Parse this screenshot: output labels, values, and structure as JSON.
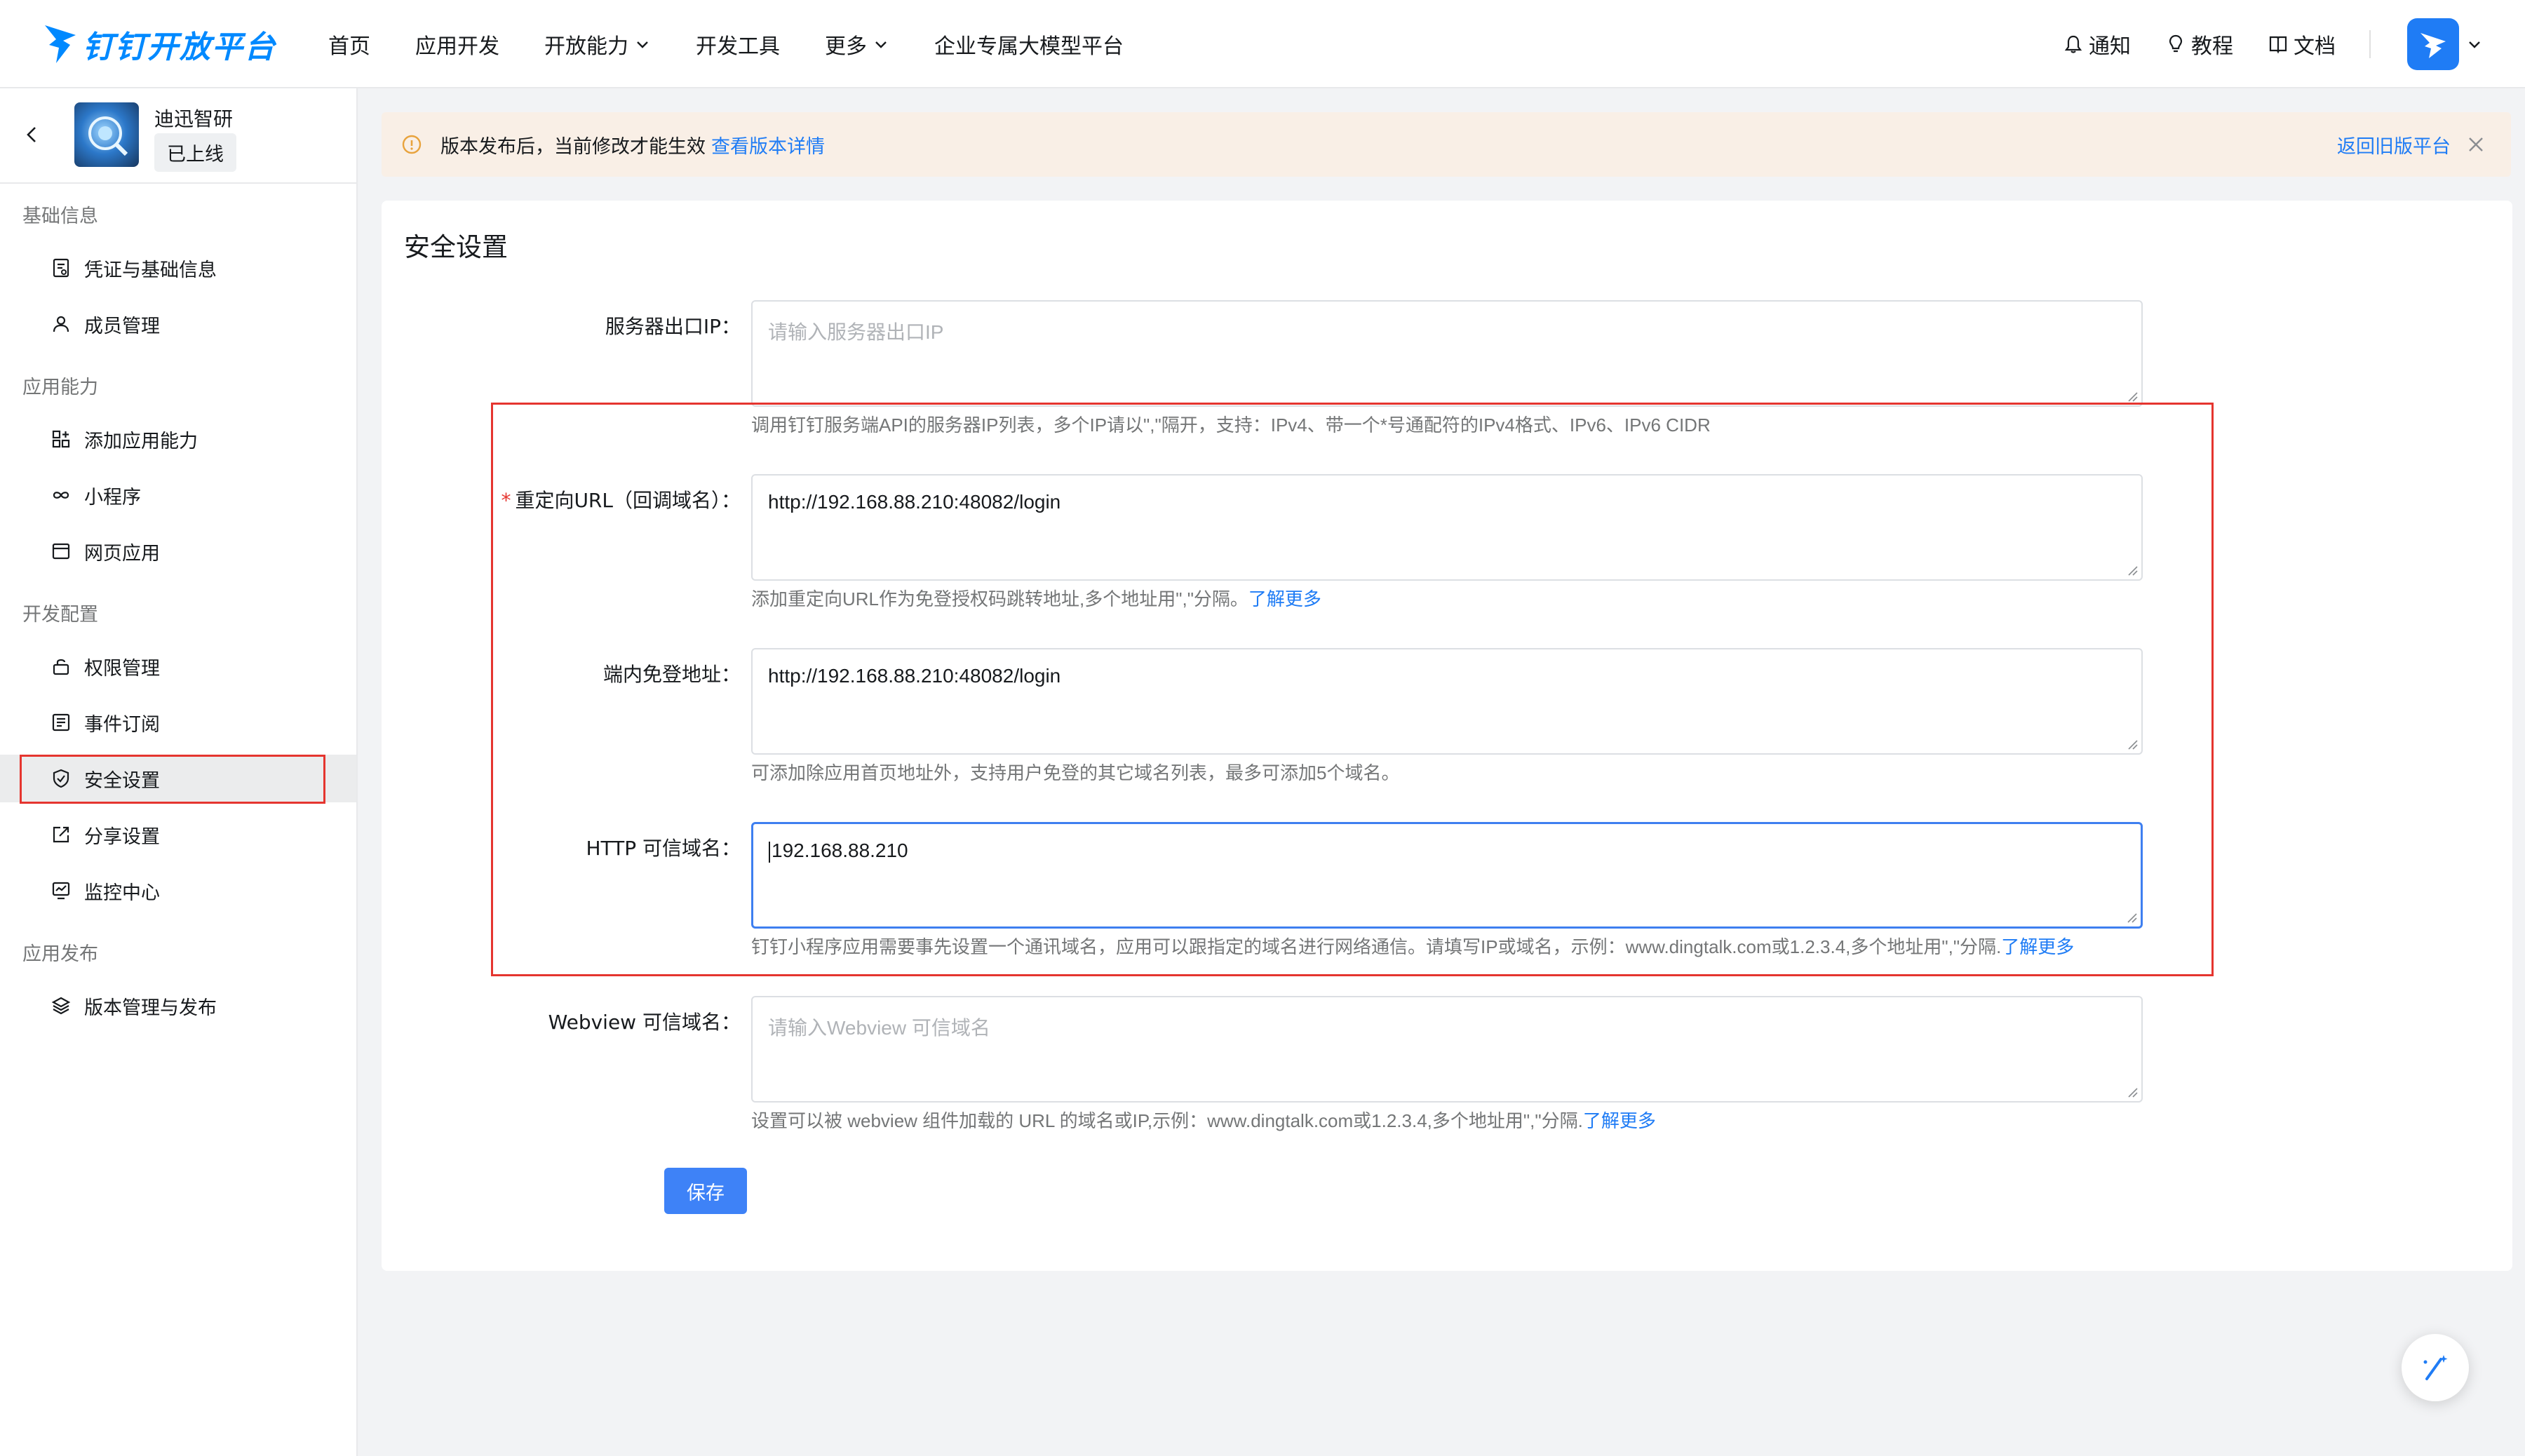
{
  "header": {
    "logo_text": "钉钉开放平台",
    "nav": [
      "首页",
      "应用开发",
      "开放能力",
      "开发工具",
      "更多",
      "企业专属大模型平台"
    ],
    "notify_label": "通知",
    "tutorial_label": "教程",
    "docs_label": "文档"
  },
  "sidebar": {
    "app_name": "迪迅智研",
    "app_status": "已上线",
    "sections": {
      "basic": "基础信息",
      "capability": "应用能力",
      "dev_config": "开发配置",
      "publish": "应用发布"
    },
    "items": {
      "credentials": "凭证与基础信息",
      "members": "成员管理",
      "add_capability": "添加应用能力",
      "mini_program": "小程序",
      "web_app": "网页应用",
      "permissions": "权限管理",
      "events": "事件订阅",
      "security": "安全设置",
      "share": "分享设置",
      "monitor": "监控中心",
      "versions": "版本管理与发布"
    },
    "active_item": "安全设置"
  },
  "notice": {
    "text": "版本发布后，当前修改才能生效",
    "link": "查看版本详情",
    "back": "返回旧版平台",
    "color": "#f9efe6"
  },
  "main": {
    "title": "安全设置",
    "fields": {
      "server_ip": {
        "label": "服务器出口IP：",
        "placeholder": "请输入服务器出口IP",
        "value": "",
        "hint": "调用钉钉服务端API的服务器IP列表，多个IP请以\",\"隔开，支持：IPv4、带一个*号通配符的IPv4格式、IPv6、IPv6 CIDR"
      },
      "redirect_url": {
        "label": "重定向URL（回调域名）：",
        "required": "*",
        "value": "http://192.168.88.210:48082/login",
        "hint": "添加重定向URL作为免登授权码跳转地址,多个地址用\",\"分隔。",
        "hint_link": "了解更多"
      },
      "inapp_login": {
        "label": "端内免登地址：",
        "value": "http://192.168.88.210:48082/login",
        "hint": "可添加除应用首页地址外，支持用户免登的其它域名列表，最多可添加5个域名。"
      },
      "http_domain": {
        "label": "HTTP 可信域名：",
        "value": "192.168.88.210",
        "hint": "钉钉小程序应用需要事先设置一个通讯域名，应用可以跟指定的域名进行网络通信。请填写IP或域名，示例：www.dingtalk.com或1.2.3.4,多个地址用\",\"分隔.",
        "hint_link": "了解更多"
      },
      "webview_domain": {
        "label": "Webview 可信域名：",
        "placeholder": "请输入Webview 可信域名",
        "value": "",
        "hint": "设置可以被 webview 组件加载的 URL 的域名或IP,示例：www.dingtalk.com或1.2.3.4,多个地址用\",\"分隔.",
        "hint_link": "了解更多"
      }
    },
    "save_label": "保存"
  },
  "colors": {
    "accent": "#1f7cf5",
    "button": "#3e82f7",
    "highlight_box": "#e5352f"
  }
}
